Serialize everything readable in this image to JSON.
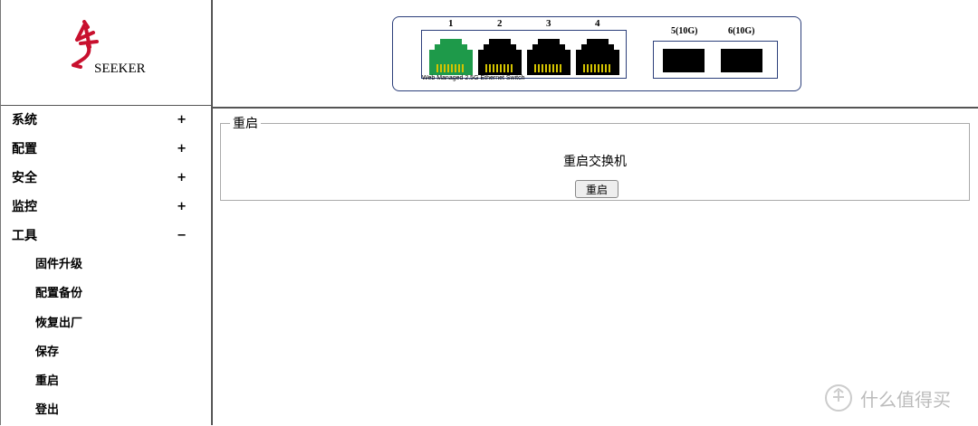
{
  "logo": {
    "text": "SEEKER"
  },
  "menu": [
    {
      "label": "系统",
      "toggle": "+"
    },
    {
      "label": "配置",
      "toggle": "+"
    },
    {
      "label": "安全",
      "toggle": "+"
    },
    {
      "label": "监控",
      "toggle": "+"
    },
    {
      "label": "工具",
      "toggle": "−"
    }
  ],
  "submenu": [
    "固件升级",
    "配置备份",
    "恢复出厂",
    "保存",
    "重启",
    "登出"
  ],
  "device": {
    "ports": [
      "1",
      "2",
      "3",
      "4"
    ],
    "sfp_ports": [
      "5(10G)",
      "6(10G)"
    ],
    "caption": "Web Managed 2.5G Ethernet Switch",
    "active_port_color": "#1e9a4a"
  },
  "content": {
    "legend": "重启",
    "title": "重启交换机",
    "button": "重启"
  },
  "watermark": "什么值得买"
}
